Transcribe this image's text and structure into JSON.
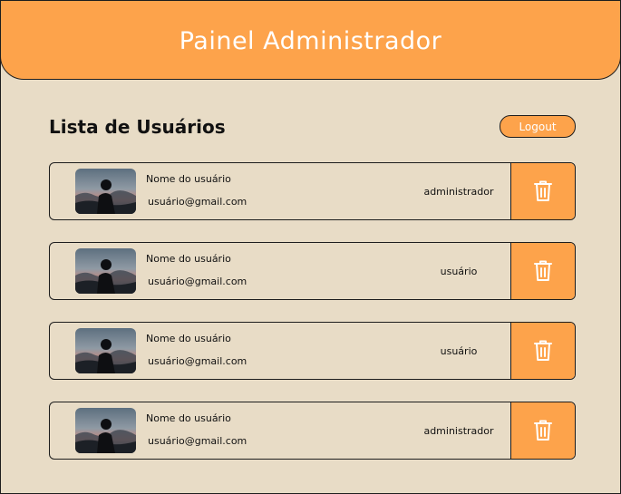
{
  "header": {
    "title": "Painel Administrador"
  },
  "main": {
    "list_title": "Lista de Usuários",
    "logout_label": "Logout"
  },
  "users": [
    {
      "name": "Nome do usuário",
      "email": "usuário@gmail.com",
      "role": "administrador"
    },
    {
      "name": "Nome do usuário",
      "email": "usuário@gmail.com",
      "role": "usuário"
    },
    {
      "name": "Nome do usuário",
      "email": "usuário@gmail.com",
      "role": "usuário"
    },
    {
      "name": "Nome do usuário",
      "email": "usuário@gmail.com",
      "role": "administrador"
    }
  ],
  "icons": {
    "delete": "trash-icon",
    "avatar": "avatar-photo"
  },
  "colors": {
    "accent": "#fda34b",
    "background": "#e8dcc6",
    "border": "#1d1d1d",
    "header_text": "#ffffff"
  }
}
